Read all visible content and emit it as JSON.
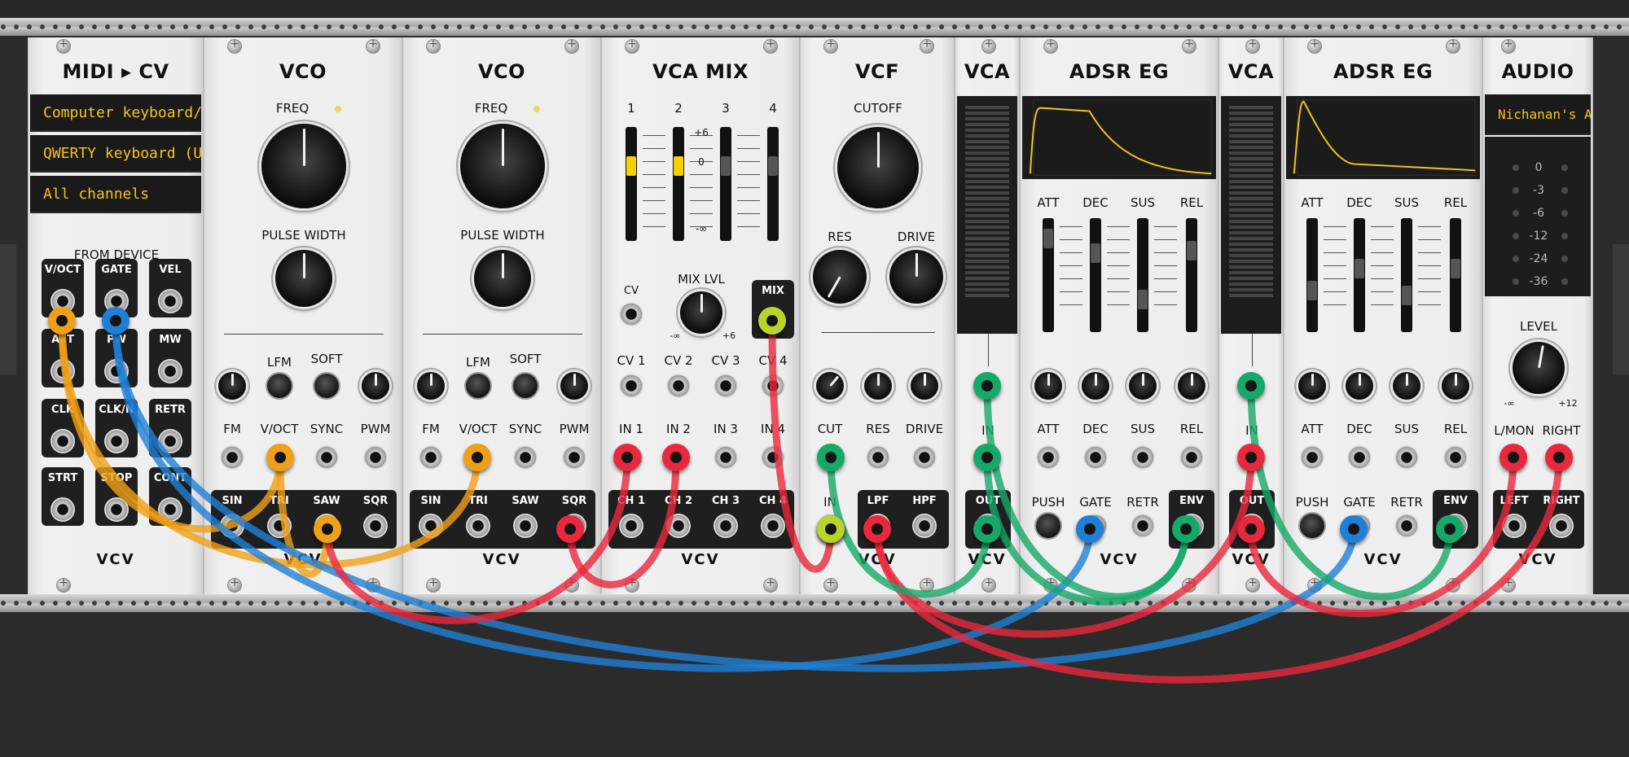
{
  "modules": {
    "midi": {
      "title": "MIDI ▸ CV",
      "driver": "Computer keyboard/mouse",
      "device": "QWERTY keyboard (US)",
      "channel": "All channels",
      "section": "FROM DEVICE",
      "jacks": [
        "V/OCT",
        "GATE",
        "VEL",
        "AFT",
        "PW",
        "MW",
        "CLK",
        "CLK/N",
        "RETR",
        "STRT",
        "STOP",
        "CONT"
      ],
      "brand": "VCV"
    },
    "vco1": {
      "title": "VCO",
      "freq": "FREQ",
      "pw": "PULSE WIDTH",
      "lfm": "LFM",
      "soft": "SOFT",
      "inputs": [
        "FM",
        "V/OCT",
        "SYNC",
        "PWM"
      ],
      "outputs": [
        "SIN",
        "TRI",
        "SAW",
        "SQR"
      ],
      "brand": "VCV"
    },
    "vco2": {
      "title": "VCO",
      "freq": "FREQ",
      "pw": "PULSE WIDTH",
      "lfm": "LFM",
      "soft": "SOFT",
      "inputs": [
        "FM",
        "V/OCT",
        "SYNC",
        "PWM"
      ],
      "outputs": [
        "SIN",
        "TRI",
        "SAW",
        "SQR"
      ],
      "brand": "VCV"
    },
    "vcamix": {
      "title": "VCA MIX",
      "channels": [
        "1",
        "2",
        "3",
        "4"
      ],
      "scale": [
        "+6",
        "0",
        "-∞"
      ],
      "cv": "CV",
      "mixlvl": "MIX LVL",
      "mixlo": "-∞",
      "mixhi": "+6",
      "mix": "MIX",
      "cvs": [
        "CV 1",
        "CV 2",
        "CV 3",
        "CV 4"
      ],
      "ins": [
        "IN 1",
        "IN 2",
        "IN 3",
        "IN 4"
      ],
      "chs": [
        "CH 1",
        "CH 2",
        "CH 3",
        "CH 4"
      ],
      "brand": "VCV"
    },
    "vcf": {
      "title": "VCF",
      "cutoff": "CUTOFF",
      "res": "RES",
      "drive": "DRIVE",
      "cv": [
        "CUT",
        "RES",
        "DRIVE"
      ],
      "in": "IN",
      "lpf": "LPF",
      "hpf": "HPF",
      "brand": "VCV"
    },
    "vca1": {
      "title": "VCA",
      "in": "IN",
      "out": "OUT",
      "brand": "VCV"
    },
    "adsr1": {
      "title": "ADSR EG",
      "params": [
        "ATT",
        "DEC",
        "SUS",
        "REL"
      ],
      "push": "PUSH",
      "gate": "GATE",
      "retr": "RETR",
      "env": "ENV",
      "brand": "VCV"
    },
    "vca2": {
      "title": "VCA",
      "in": "IN",
      "out": "OUT",
      "brand": "VCV"
    },
    "adsr2": {
      "title": "ADSR EG",
      "params": [
        "ATT",
        "DEC",
        "SUS",
        "REL"
      ],
      "push": "PUSH",
      "gate": "GATE",
      "retr": "RETR",
      "env": "ENV",
      "brand": "VCV"
    },
    "audio": {
      "title": "AUDIO",
      "device": "Nichanan's AirPods",
      "db": [
        "0",
        "-3",
        "-6",
        "-12",
        "-24",
        "-36"
      ],
      "level": "LEVEL",
      "lo": "-∞",
      "hi": "+12",
      "inputs": [
        "L/MON",
        "RIGHT"
      ],
      "outputs": [
        "LEFT",
        "RIGHT"
      ],
      "brand": "VCV"
    }
  },
  "colors": {
    "yellow": "#f0a018",
    "blue": "#1f7fd6",
    "red": "#e8283c",
    "green": "#16a86a",
    "lime": "#b8d42a"
  }
}
